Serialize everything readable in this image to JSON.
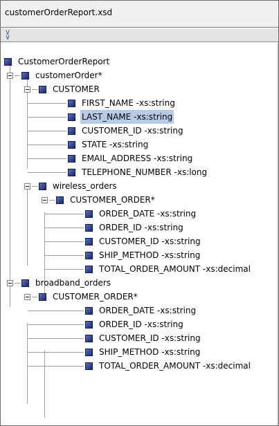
{
  "window": {
    "title": "customerOrderReport.xsd"
  },
  "toolbar": {
    "collapse_icon": "double-chevron-down-icon"
  },
  "tree": {
    "root": "CustomerOrderReport",
    "nodes": [
      "customerOrder*",
      "CUSTOMER",
      "FIRST_NAME -xs:string",
      "LAST_NAME -xs:string",
      "CUSTOMER_ID -xs:string",
      "STATE -xs:string",
      "EMAIL_ADDRESS -xs:string",
      "TELEPHONE_NUMBER -xs:long",
      "wireless_orders",
      "CUSTOMER_ORDER*",
      "ORDER_DATE -xs:string",
      "ORDER_ID -xs:string",
      "CUSTOMER_ID -xs:string",
      "SHIP_METHOD -xs:string",
      "TOTAL_ORDER_AMOUNT -xs:decimal",
      "broadband_orders",
      "CUSTOMER_ORDER*",
      "ORDER_DATE -xs:string",
      "ORDER_ID -xs:string",
      "CUSTOMER_ID -xs:string",
      "SHIP_METHOD -xs:string",
      "TOTAL_ORDER_AMOUNT -xs:decimal"
    ],
    "selected_index": 3
  }
}
